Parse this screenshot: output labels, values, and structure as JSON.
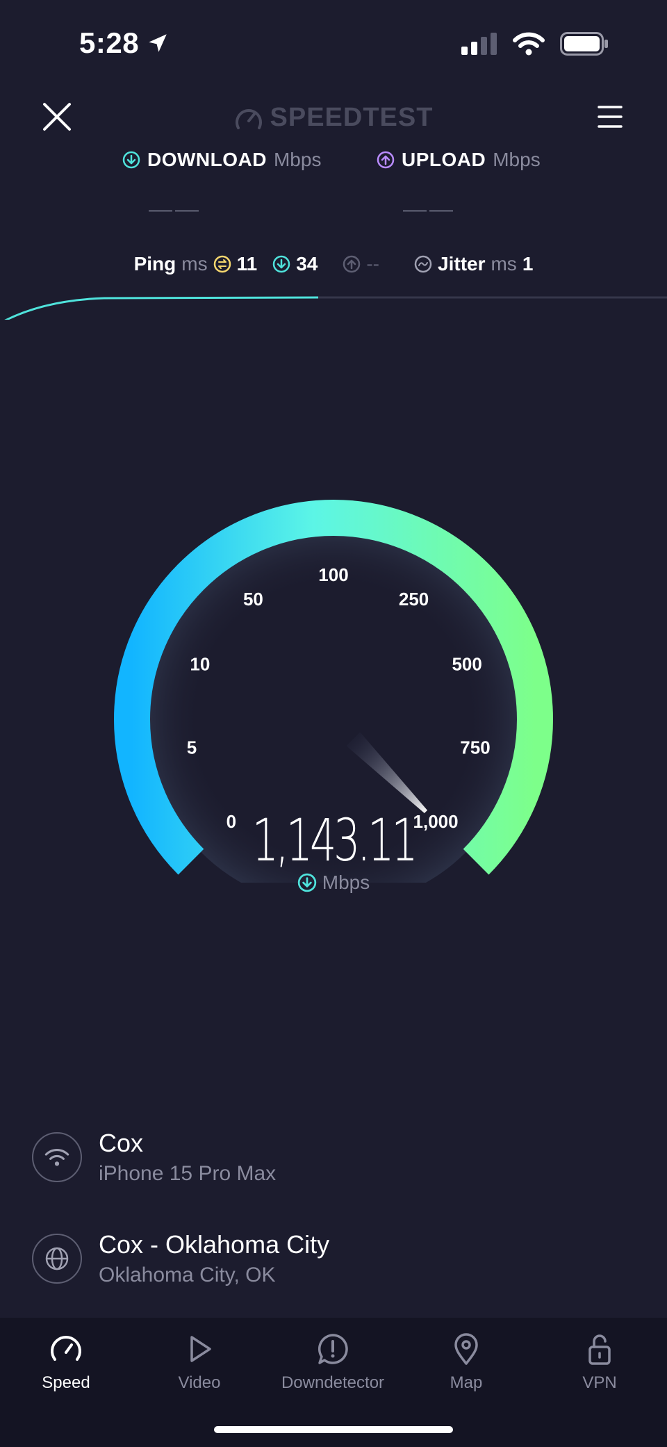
{
  "status_bar": {
    "time": "5:28"
  },
  "header": {
    "brand": "SPEEDTEST"
  },
  "metrics": {
    "download": {
      "label": "DOWNLOAD",
      "unit": "Mbps",
      "value": "——"
    },
    "upload": {
      "label": "UPLOAD",
      "unit": "Mbps",
      "value": "——"
    }
  },
  "ping": {
    "label": "Ping",
    "unit": "ms",
    "idle": "11",
    "download": "34",
    "upload": "--",
    "jitter_label": "Jitter",
    "jitter_unit": "ms",
    "jitter_value": "1"
  },
  "gauge": {
    "ticks": [
      "0",
      "5",
      "10",
      "50",
      "100",
      "250",
      "500",
      "750",
      "1,000"
    ],
    "value": "1,143.11",
    "unit": "Mbps",
    "needle_fraction": 1.0
  },
  "connection": {
    "provider": "Cox",
    "device": "iPhone 15 Pro Max",
    "server": "Cox - Oklahoma City",
    "location": "Oklahoma City, OK"
  },
  "tabs": [
    {
      "label": "Speed",
      "icon": "speedometer-icon",
      "active": true
    },
    {
      "label": "Video",
      "icon": "play-icon",
      "active": false
    },
    {
      "label": "Downdetector",
      "icon": "alert-icon",
      "active": false
    },
    {
      "label": "Map",
      "icon": "map-pin-icon",
      "active": false
    },
    {
      "label": "VPN",
      "icon": "unlock-icon",
      "active": false
    }
  ],
  "colors": {
    "background": "#1c1c2e",
    "download_accent": "#4fe3dc",
    "upload_accent": "#b98cff",
    "ping_idle": "#f5d76e",
    "gauge_start": "#1ab8ff",
    "gauge_mid": "#5cf5e0",
    "gauge_end": "#7dff8a"
  }
}
